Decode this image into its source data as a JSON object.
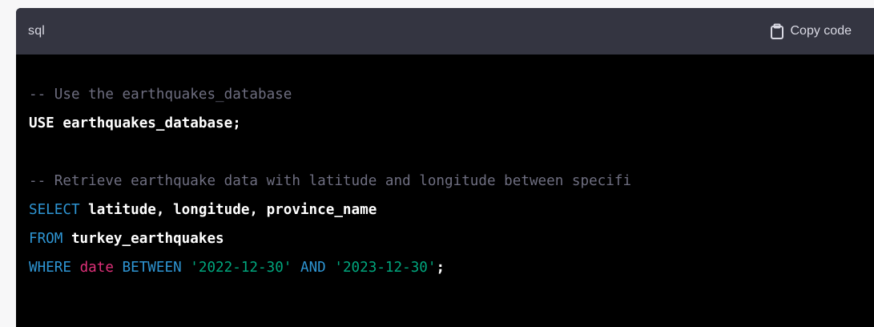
{
  "header": {
    "language": "sql",
    "copy_label": "Copy code",
    "copy_icon": "clipboard-icon"
  },
  "colors": {
    "header_bg": "#343541",
    "code_bg": "#000000",
    "comment": "#6e6e80",
    "keyword": "#2e95d3",
    "builtin": "#df3079",
    "string": "#00a67d",
    "plain": "#ffffff"
  },
  "code": {
    "line1": {
      "comment": "-- Use the earthquakes_database"
    },
    "line2": {
      "text": "USE earthquakes_database;"
    },
    "line4": {
      "comment": "-- Retrieve earthquake data with latitude and longitude between specifi"
    },
    "line5": {
      "keyword": "SELECT",
      "text": " latitude, longitude, province_name"
    },
    "line6": {
      "keyword": "FROM",
      "text": " turkey_earthquakes"
    },
    "line7": {
      "keyword_where": "WHERE",
      "space1": " ",
      "builtin_date": "date",
      "space2": " ",
      "keyword_between": "BETWEEN",
      "space3": " ",
      "string_start": "'2022-12-30'",
      "space4": " ",
      "keyword_and": "AND",
      "space5": " ",
      "string_end": "'2023-12-30'",
      "terminator": ";"
    }
  }
}
